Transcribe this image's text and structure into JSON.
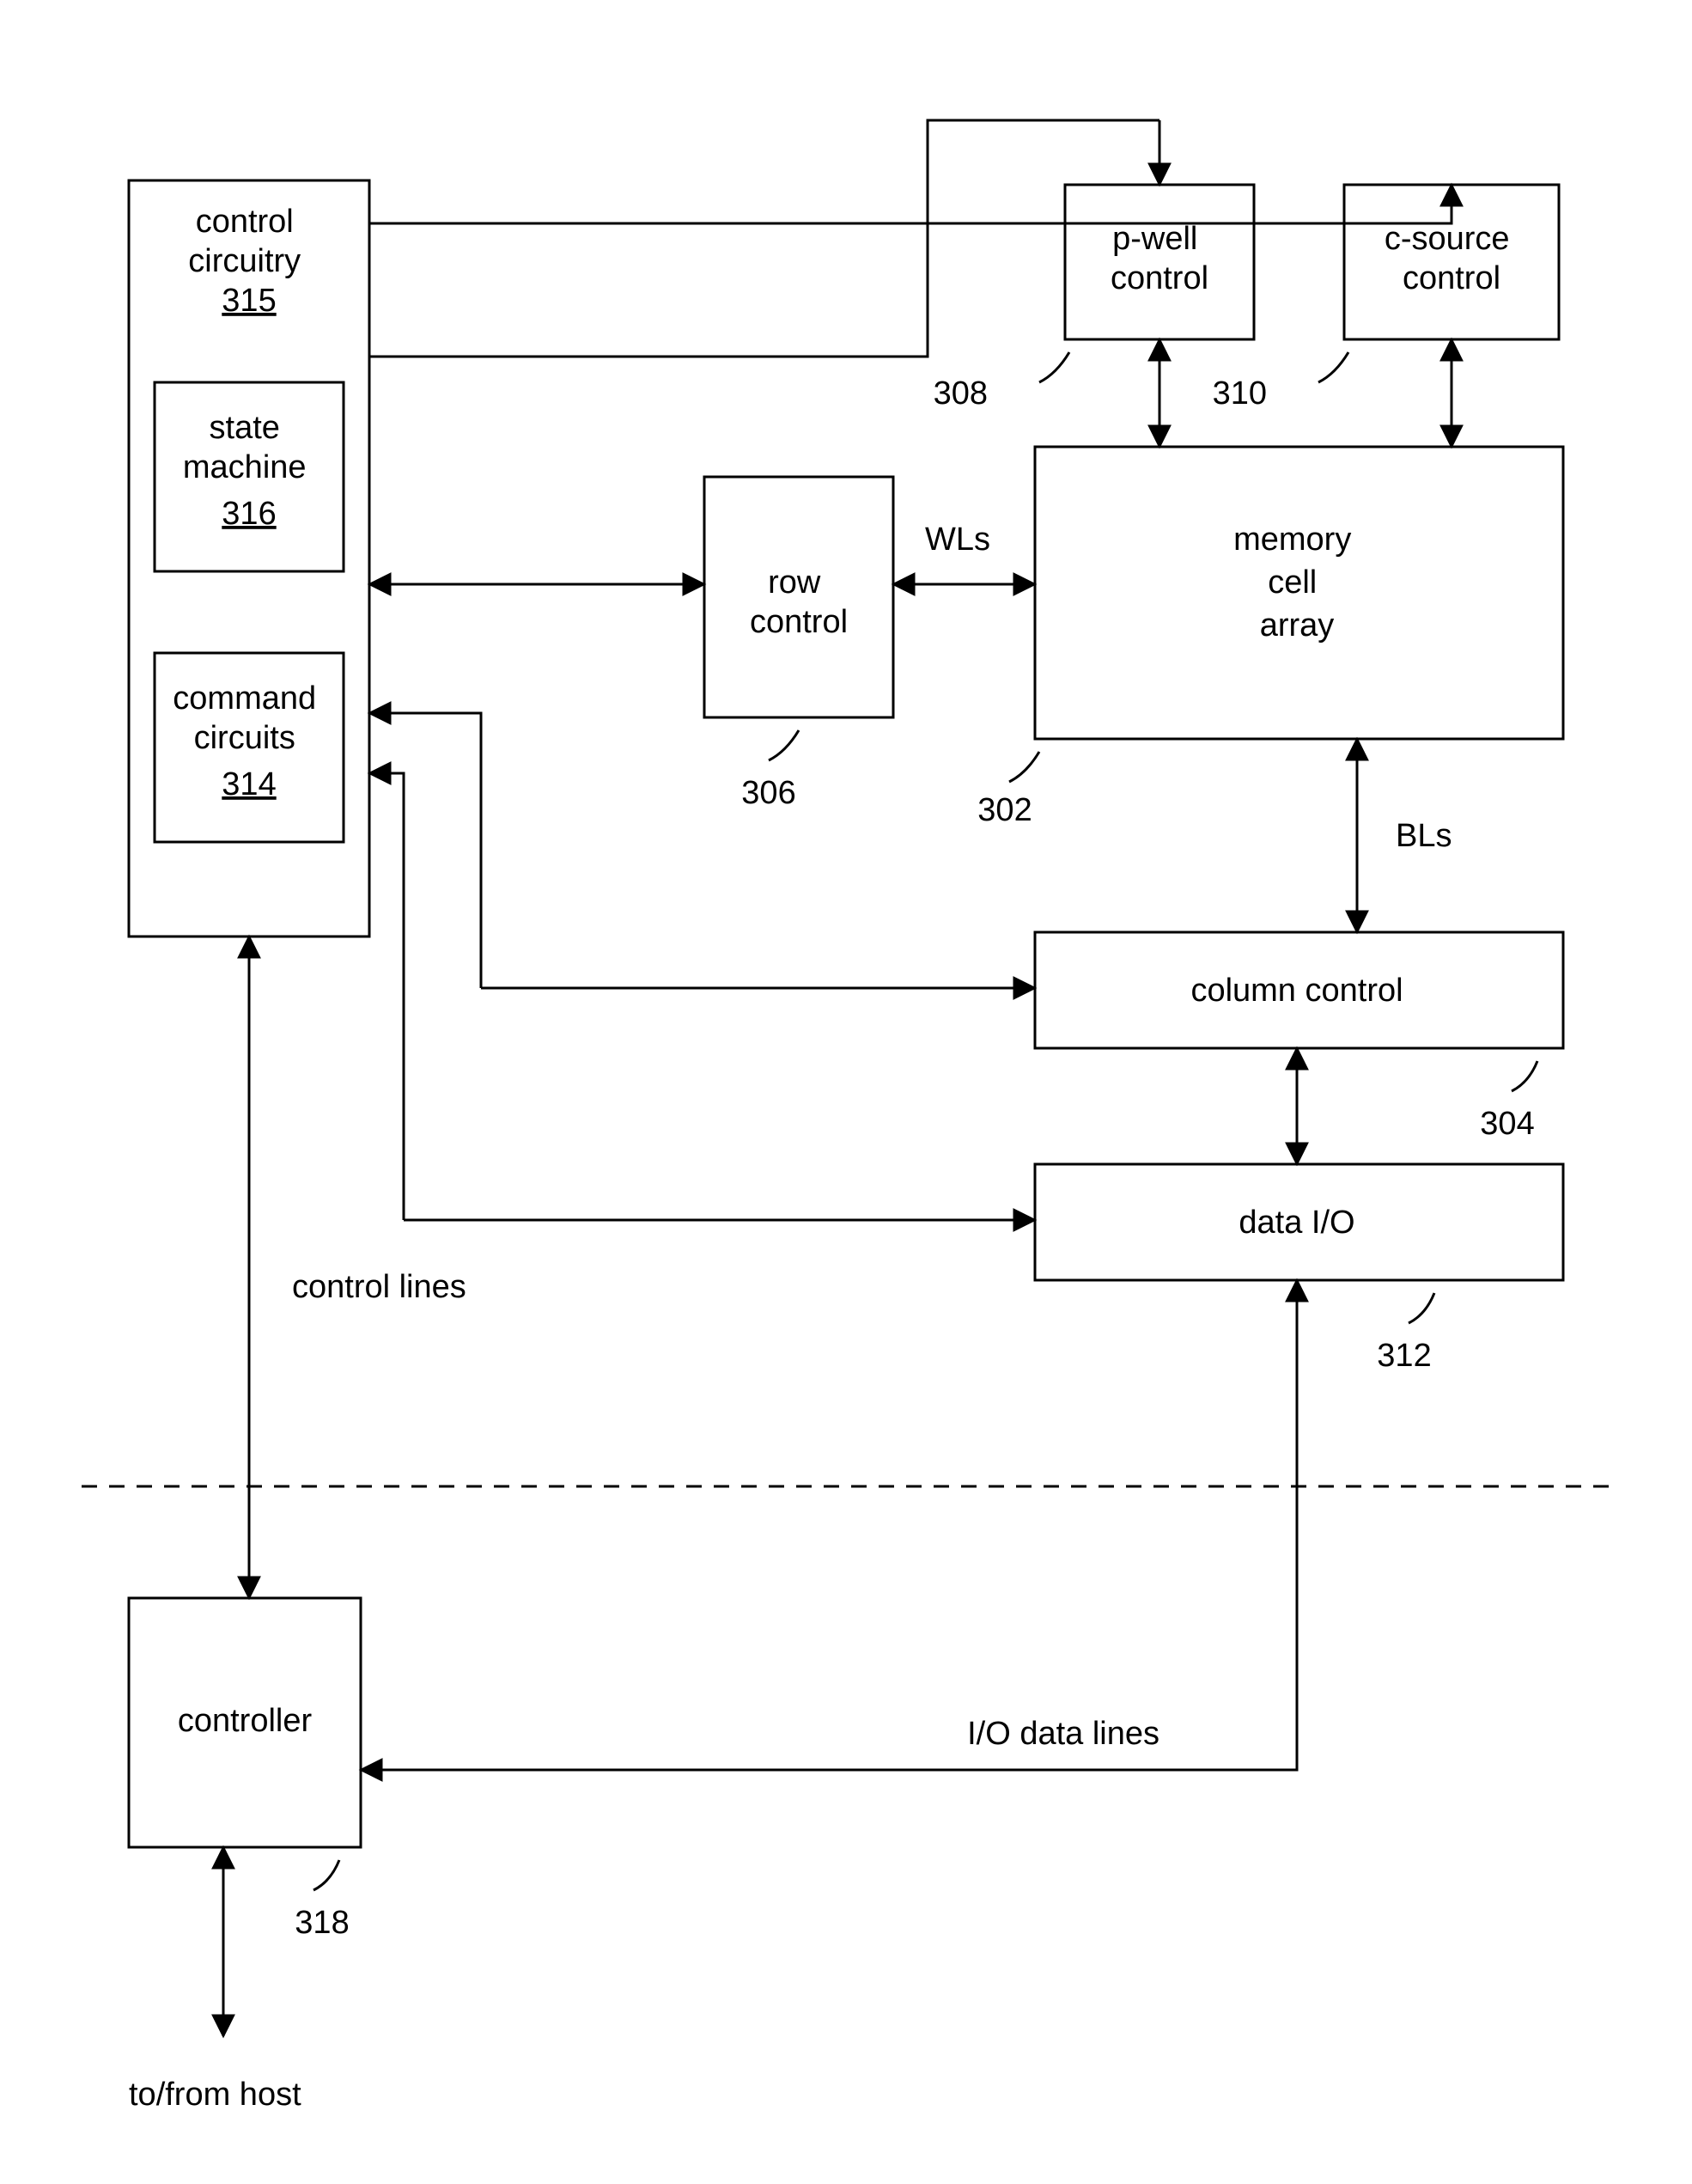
{
  "blocks": {
    "control_circuitry": {
      "label": "control circuitry",
      "ref": "315"
    },
    "state_machine": {
      "label": "state machine",
      "ref": "316"
    },
    "command_circuits": {
      "label": "command circuits",
      "ref": "314"
    },
    "pwell": {
      "label": "p-well control",
      "ref": "308"
    },
    "csource": {
      "label": "c-source control",
      "ref": "310"
    },
    "row_control": {
      "label": "row control",
      "ref": "306"
    },
    "memory": {
      "label": "memory cell array",
      "ref": "302"
    },
    "column_control": {
      "label": "column control",
      "ref": "304"
    },
    "data_io": {
      "label": "data I/O",
      "ref": "312"
    },
    "controller": {
      "label": "controller",
      "ref": "318"
    }
  },
  "labels": {
    "wls": "WLs",
    "bls": "BLs",
    "control_lines": "control lines",
    "io_data_lines": "I/O data lines",
    "to_from_host": "to/from host"
  }
}
